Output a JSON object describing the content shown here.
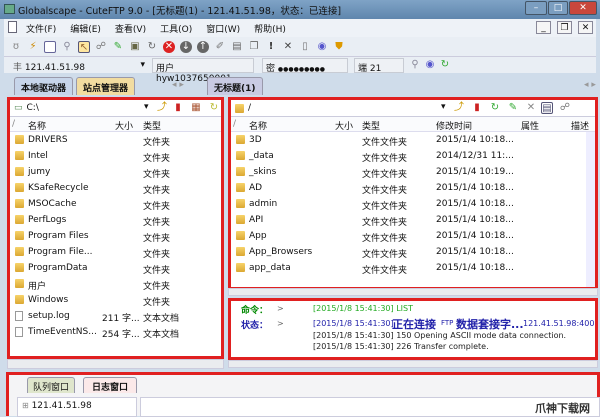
{
  "window": {
    "title": "Globalscape - CuteFTP 9.0 - [无标题(1) - 121.41.51.98，状态：已连接]"
  },
  "menu": [
    "文件(F)",
    "编辑(E)",
    "查看(V)",
    "工具(O)",
    "窗口(W)",
    "帮助(H)"
  ],
  "connection": {
    "host": "121.41.51.98",
    "user_label": "用户",
    "user": "hyw1037650001",
    "password_label": "密",
    "password": "●●●●●●●●●",
    "port_label": "端",
    "port": "21"
  },
  "left_tabs": [
    "本地驱动器",
    "站点管理器"
  ],
  "right_tab": "无标题(1)",
  "local": {
    "path": "C:\\",
    "columns": [
      "名称",
      "大小",
      "类型"
    ],
    "rows": [
      {
        "name": "DRIVERS",
        "size": "",
        "type": "文件夹",
        "icon": "folder"
      },
      {
        "name": "Intel",
        "size": "",
        "type": "文件夹",
        "icon": "folder"
      },
      {
        "name": "jumy",
        "size": "",
        "type": "文件夹",
        "icon": "folder"
      },
      {
        "name": "KSafeRecycle",
        "size": "",
        "type": "文件夹",
        "icon": "folder"
      },
      {
        "name": "MSOCache",
        "size": "",
        "type": "文件夹",
        "icon": "folder"
      },
      {
        "name": "PerfLogs",
        "size": "",
        "type": "文件夹",
        "icon": "folder"
      },
      {
        "name": "Program Files",
        "size": "",
        "type": "文件夹",
        "icon": "folder"
      },
      {
        "name": "Program File...",
        "size": "",
        "type": "文件夹",
        "icon": "folder"
      },
      {
        "name": "ProgramData",
        "size": "",
        "type": "文件夹",
        "icon": "folder"
      },
      {
        "name": "用户",
        "size": "",
        "type": "文件夹",
        "icon": "folder"
      },
      {
        "name": "Windows",
        "size": "",
        "type": "文件夹",
        "icon": "folder"
      },
      {
        "name": "setup.log",
        "size": "211 字...",
        "type": "文本文档",
        "icon": "file"
      },
      {
        "name": "TimeEventNS...",
        "size": "254 字...",
        "type": "文本文档",
        "icon": "file"
      }
    ]
  },
  "remote": {
    "path": "/",
    "columns": [
      "名称",
      "大小",
      "类型",
      "修改时间",
      "属性",
      "描述"
    ],
    "rows": [
      {
        "name": "3D",
        "type": "文件文件夹",
        "modified": "2015/1/4 10:18..."
      },
      {
        "name": "_data",
        "type": "文件文件夹",
        "modified": "2014/12/31 11:..."
      },
      {
        "name": "_skins",
        "type": "文件文件夹",
        "modified": "2015/1/4 10:19..."
      },
      {
        "name": "AD",
        "type": "文件文件夹",
        "modified": "2015/1/4 10:18..."
      },
      {
        "name": "admin",
        "type": "文件文件夹",
        "modified": "2015/1/4 10:18..."
      },
      {
        "name": "API",
        "type": "文件文件夹",
        "modified": "2015/1/4 10:18..."
      },
      {
        "name": "App",
        "type": "文件文件夹",
        "modified": "2015/1/4 10:18..."
      },
      {
        "name": "App_Browsers",
        "type": "文件文件夹",
        "modified": "2015/1/4 10:18..."
      },
      {
        "name": "app_data",
        "type": "文件文件夹",
        "modified": "2015/1/4 10:18..."
      }
    ]
  },
  "log": {
    "cmd_label": "命令：",
    "status_label": "状态：",
    "arrow": ">",
    "lines": [
      "[2015/1/8 15:41:30] LIST",
      "[2015/1/8 15:41:30]",
      "正在连接",
      "FTP",
      "数据套接字...",
      "121.41.51.98:400",
      "[2015/1/8 15:41:30] 150 Opening ASCII mode data connection.",
      "[2015/1/8 15:41:30] 226 Transfer complete."
    ]
  },
  "bottom": {
    "tabs": [
      "队列窗口",
      "日志窗口"
    ],
    "tree_item": "121.41.51.98"
  },
  "watermark": "爪神下载网"
}
